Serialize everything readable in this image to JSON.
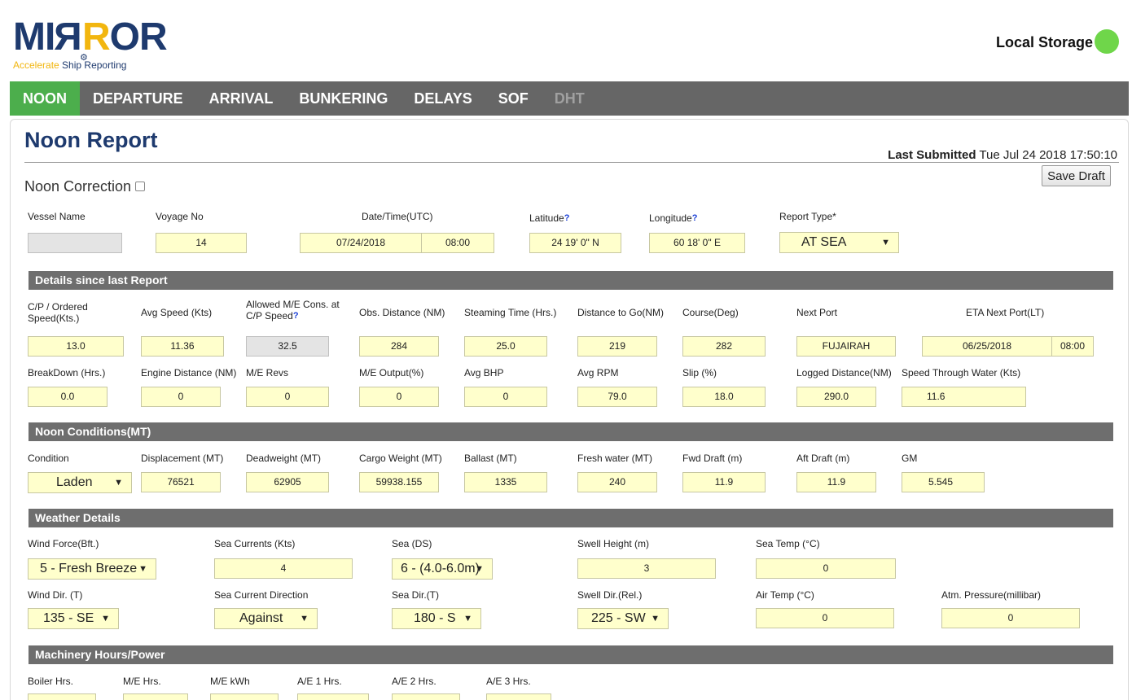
{
  "brand": {
    "logo_text": "MIRROR",
    "tagline_a": "Accelerate",
    "tagline_b": "Ship Reporting"
  },
  "storage": {
    "label": "Local Storage",
    "status_color": "#6fd64a"
  },
  "nav": {
    "tabs": [
      "NOON",
      "DEPARTURE",
      "ARRIVAL",
      "BUNKERING",
      "DELAYS",
      "SOF",
      "DHT"
    ],
    "active": "NOON",
    "disabled": "DHT"
  },
  "page": {
    "title": "Noon Report",
    "last_submitted_label": "Last Submitted",
    "last_submitted_value": "Tue Jul 24 2018 17:50:10",
    "save_label": "Save Draft",
    "correction_label": "Noon Correction"
  },
  "header_fields": {
    "vessel_name": {
      "label": "Vessel Name",
      "value": ""
    },
    "voyage_no": {
      "label": "Voyage No",
      "value": "14"
    },
    "datetime": {
      "label": "Date/Time(UTC)",
      "date": "07/24/2018",
      "time": "08:00"
    },
    "latitude": {
      "label": "Latitude",
      "value": "24 19' 0\" N"
    },
    "longitude": {
      "label": "Longitude",
      "value": "60 18' 0\" E"
    },
    "report_type": {
      "label": "Report Type*",
      "value": "AT SEA"
    },
    "help": "?"
  },
  "sections": {
    "details": "Details since last Report",
    "noon": "Noon Conditions(MT)",
    "weather": "Weather Details",
    "machinery": "Machinery Hours/Power"
  },
  "details": {
    "cp_speed": {
      "label": "C/P / Ordered Speed(Kts.)",
      "value": "13.0"
    },
    "avg_speed": {
      "label": "Avg Speed (Kts)",
      "value": "11.36"
    },
    "allowed_me": {
      "label": "Allowed M/E Cons. at C/P Speed",
      "value": "32.5"
    },
    "obs_distance": {
      "label": "Obs. Distance (NM)",
      "value": "284"
    },
    "steaming_time": {
      "label": "Steaming Time (Hrs.)",
      "value": "25.0"
    },
    "distance_to_go": {
      "label": "Distance to Go(NM)",
      "value": "219"
    },
    "course": {
      "label": "Course(Deg)",
      "value": "282"
    },
    "next_port": {
      "label": "Next Port",
      "value": "FUJAIRAH"
    },
    "eta": {
      "label": "ETA Next Port(LT)",
      "date": "06/25/2018",
      "time": "08:00"
    },
    "breakdown": {
      "label": "BreakDown (Hrs.)",
      "value": "0.0"
    },
    "engine_distance": {
      "label": "Engine Distance (NM)",
      "value": "0"
    },
    "me_revs": {
      "label": "M/E Revs",
      "value": "0"
    },
    "me_output": {
      "label": "M/E Output(%)",
      "value": "0"
    },
    "avg_bhp": {
      "label": "Avg BHP",
      "value": "0"
    },
    "avg_rpm": {
      "label": "Avg RPM",
      "value": "79.0"
    },
    "slip": {
      "label": "Slip (%)",
      "value": "18.0"
    },
    "logged_distance": {
      "label": "Logged Distance(NM)",
      "value": "290.0"
    },
    "stw": {
      "label": "Speed Through Water (Kts)",
      "value": "11.6"
    }
  },
  "noon": {
    "condition": {
      "label": "Condition",
      "value": "Laden"
    },
    "displacement": {
      "label": "Displacement (MT)",
      "value": "76521"
    },
    "deadweight": {
      "label": "Deadweight (MT)",
      "value": "62905"
    },
    "cargo": {
      "label": "Cargo Weight (MT)",
      "value": "59938.155"
    },
    "ballast": {
      "label": "Ballast (MT)",
      "value": "1335"
    },
    "fresh_water": {
      "label": "Fresh water (MT)",
      "value": "240"
    },
    "fwd_draft": {
      "label": "Fwd Draft (m)",
      "value": "11.9"
    },
    "aft_draft": {
      "label": "Aft Draft (m)",
      "value": "11.9"
    },
    "gm": {
      "label": "GM",
      "value": "5.545"
    }
  },
  "weather": {
    "wind_force": {
      "label": "Wind Force(Bft.)",
      "value": "5 - Fresh Breeze"
    },
    "sea_currents": {
      "label": "Sea Currents (Kts)",
      "value": "4"
    },
    "sea_ds": {
      "label": "Sea (DS)",
      "value": "6 - (4.0-6.0m)"
    },
    "swell_height": {
      "label": "Swell Height (m)",
      "value": "3"
    },
    "sea_temp": {
      "label": "Sea Temp (°C)",
      "value": "0"
    },
    "wind_dir": {
      "label": "Wind Dir. (T)",
      "value": "135 - SE"
    },
    "current_dir": {
      "label": "Sea Current Direction",
      "value": "Against"
    },
    "sea_dir": {
      "label": "Sea Dir.(T)",
      "value": "180 - S"
    },
    "swell_dir": {
      "label": "Swell Dir.(Rel.)",
      "value": "225 - SW"
    },
    "air_temp": {
      "label": "Air Temp (°C)",
      "value": "0"
    },
    "atm_pressure": {
      "label": "Atm. Pressure(millibar)",
      "value": "0"
    }
  },
  "machinery": {
    "boiler": {
      "label": "Boiler Hrs."
    },
    "me_hrs": {
      "label": "M/E Hrs."
    },
    "me_kwh": {
      "label": "M/E kWh"
    },
    "ae1": {
      "label": "A/E 1 Hrs."
    },
    "ae2": {
      "label": "A/E 2 Hrs."
    },
    "ae3": {
      "label": "A/E 3 Hrs."
    }
  },
  "icons": {
    "dropdown": "chevron-down-icon",
    "arrow_glyph": "▼"
  }
}
